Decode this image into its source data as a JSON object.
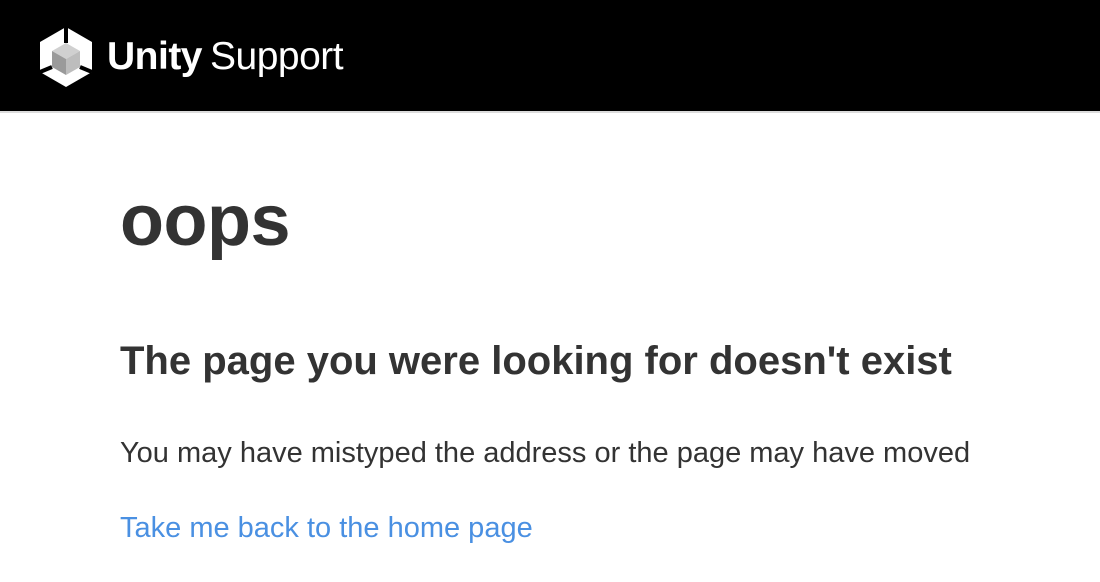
{
  "header": {
    "logo_icon": "unity-cube-icon",
    "brand_strong": "Unity",
    "brand_light": "Support",
    "background_color": "#000000"
  },
  "main": {
    "heading": "oops",
    "subheading": "The page you were looking for doesn't exist",
    "message": "You may have mistyped the address or the page may have moved",
    "home_link": "Take me back to the home page",
    "text_color": "#333333",
    "link_color": "#4a90e2"
  }
}
